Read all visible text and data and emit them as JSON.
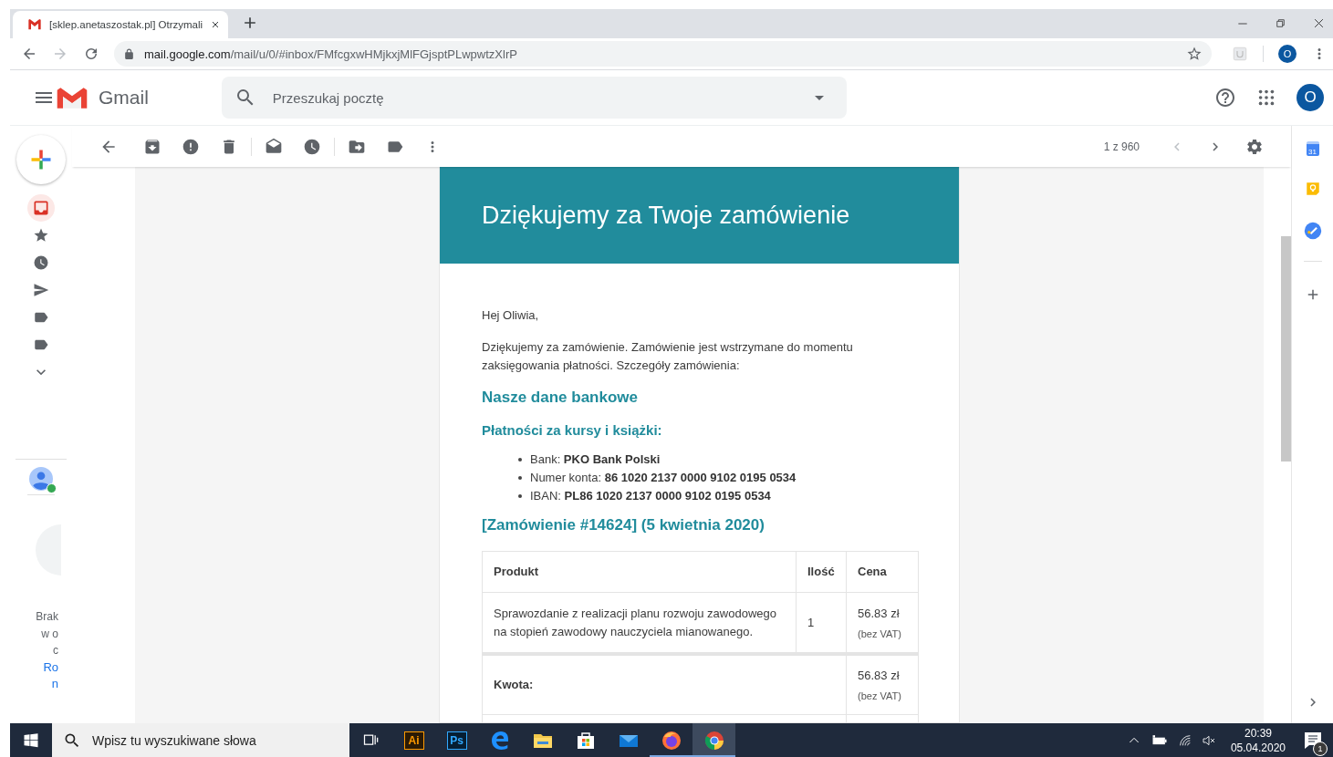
{
  "browser": {
    "tab": {
      "title": "[sklep.anetaszostak.pl] Otrzymali"
    },
    "address": {
      "host": "mail.google.com",
      "path": "/mail/u/0/#inbox/FMfcgxwHMjkxjMlFGjsptPLwpwtzXlrP"
    },
    "profile_initial": "O"
  },
  "header": {
    "product_name": "Gmail",
    "search": {
      "placeholder": "Przeszukaj pocztę"
    },
    "account_initial": "O"
  },
  "nav": {
    "items": [
      {
        "kind": "inbox",
        "selected": true
      },
      {
        "kind": "starred",
        "selected": false
      },
      {
        "kind": "snoozed",
        "selected": false
      },
      {
        "kind": "sent",
        "selected": false
      },
      {
        "kind": "label",
        "selected": false
      },
      {
        "kind": "label",
        "selected": false
      },
      {
        "kind": "more",
        "selected": false
      }
    ]
  },
  "hangouts": {
    "lines": [
      {
        "kind": "text",
        "text": "Brak"
      },
      {
        "kind": "text",
        "text": "w o"
      },
      {
        "kind": "text",
        "text": "c"
      },
      {
        "kind": "link",
        "text": "Ro"
      },
      {
        "kind": "link",
        "text": "n"
      }
    ]
  },
  "toolbar": {
    "counter": "1 z 960"
  },
  "email": {
    "banner_title": "Dziękujemy za Twoje zamówienie",
    "greeting": "Hej Oliwia,",
    "intro": "Dziękujemy za zamówienie. Zamówienie jest wstrzymane do momentu zaksięgowania płatności. Szczegóły zamówienia:",
    "bank_heading": "Nasze dane bankowe",
    "payment_heading": "Płatności za kursy i książki:",
    "bank_details": [
      "Bank: **PKO Bank Polski**",
      "Numer konta: **86 1020 2137 0000 9102 0195 0534**",
      "IBAN: **PL86 1020 2137 0000 9102 0195 0534**"
    ],
    "order_heading": "[Zamówienie #14624] (5 kwietnia 2020)",
    "order_table": {
      "columns": [
        "Produkt",
        "Ilość",
        "Cena"
      ],
      "rows": [
        {
          "product": "Sprawozdanie z realizacji planu rozwoju zawodowego na stopień zawodowy nauczyciela mianowanego.",
          "quantity": "1",
          "price": "56.83 zł",
          "price_note": "(bez VAT)"
        }
      ],
      "totals": [
        {
          "label": "Kwota:",
          "price": "56.83 zł",
          "price_note": "(bez VAT)"
        }
      ]
    }
  },
  "addons": [
    {
      "kind": "calendar",
      "label": "31"
    },
    {
      "kind": "keep"
    },
    {
      "kind": "tasks"
    }
  ],
  "taskbar": {
    "search": {
      "placeholder": "Wpisz tu wyszukiwane słowa"
    },
    "apps": [
      {
        "kind": "task-view",
        "running": false,
        "selected": false
      },
      {
        "kind": "illustrator",
        "label": "Ai",
        "running": false,
        "selected": false
      },
      {
        "kind": "photoshop",
        "label": "Ps",
        "running": false,
        "selected": false
      },
      {
        "kind": "edge",
        "running": false,
        "selected": false
      },
      {
        "kind": "explorer",
        "running": false,
        "selected": false
      },
      {
        "kind": "store",
        "running": false,
        "selected": false
      },
      {
        "kind": "mail",
        "running": false,
        "selected": false
      },
      {
        "kind": "firefox",
        "running": true,
        "selected": false
      },
      {
        "kind": "chrome",
        "running": true,
        "selected": true
      }
    ],
    "time": "20:39",
    "date": "05.04.2020",
    "notification_count": "1"
  }
}
